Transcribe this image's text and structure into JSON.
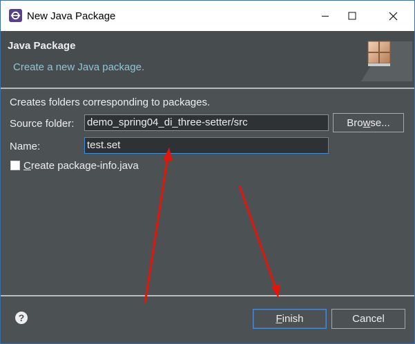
{
  "window": {
    "title": "New Java Package",
    "icon": "eclipse-icon",
    "controls": {
      "minimize_icon": "minimize-icon",
      "maximize_icon": "maximize-icon",
      "close_icon": "close-icon"
    }
  },
  "header": {
    "title": "Java Package",
    "description": "Create a new Java package.",
    "image": "package-wizard-banner-icon"
  },
  "body": {
    "intro": "Creates folders corresponding to packages.",
    "source_folder": {
      "label": "Source folder:",
      "value": "demo_spring04_di_three-setter/src",
      "browse_label_pre": "Bro",
      "browse_label_mnemonic": "w",
      "browse_label_post": "se..."
    },
    "name": {
      "label": "Name:",
      "value": "test.set"
    },
    "package_info": {
      "checked": false,
      "label_mnemonic": "C",
      "label_rest": "reate package-info.java"
    }
  },
  "footer": {
    "help_icon": "help-icon",
    "help_glyph": "?",
    "finish_mnemonic": "F",
    "finish_rest": "inish",
    "cancel_label": "Cancel"
  },
  "colors": {
    "dialog_bg": "#4c5154",
    "header_bg": "#474c4f",
    "description": "#8fc6d6",
    "focus_border": "#3d8ed8",
    "annotation_arrow": "#e3160b"
  }
}
